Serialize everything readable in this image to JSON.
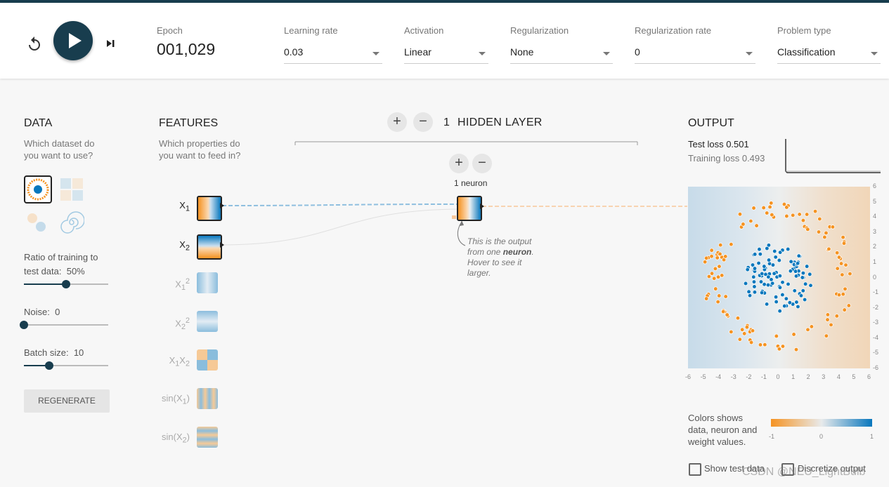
{
  "controls": {
    "reset_icon": "reset-icon",
    "play_icon": "play-icon",
    "step_icon": "step-forward-icon"
  },
  "epoch": {
    "label": "Epoch",
    "value": "001,029"
  },
  "learning_rate": {
    "label": "Learning rate",
    "value": "0.03"
  },
  "activation": {
    "label": "Activation",
    "value": "Linear"
  },
  "regularization": {
    "label": "Regularization",
    "value": "None"
  },
  "regularization_rate": {
    "label": "Regularization rate",
    "value": "0"
  },
  "problem_type": {
    "label": "Problem type",
    "value": "Classification"
  },
  "data": {
    "title": "DATA",
    "subtitle1": "Which dataset do",
    "subtitle2": "you want to use?",
    "ratio_label": "Ratio of training to",
    "ratio_label2": "test data:",
    "ratio_value": "50%",
    "ratio_fraction": 0.5,
    "noise_label": "Noise:",
    "noise_value": "0",
    "noise_fraction": 0,
    "batch_label": "Batch size:",
    "batch_value": "10",
    "batch_fraction": 0.3,
    "regenerate": "REGENERATE"
  },
  "features": {
    "title": "FEATURES",
    "subtitle1": "Which properties do",
    "subtitle2": "you want to feed in?",
    "items": [
      {
        "base": "X",
        "sub": "1",
        "sup": ""
      },
      {
        "base": "X",
        "sub": "2",
        "sup": ""
      },
      {
        "base": "X",
        "sub": "1",
        "sup": "2"
      },
      {
        "base": "X",
        "sub": "2",
        "sup": "2"
      },
      {
        "base": "X",
        "sub": "1",
        "base2": "X",
        "sub2": "2"
      },
      {
        "base": "sin(X",
        "sub": "1",
        "tail": ")"
      },
      {
        "base": "sin(X",
        "sub": "2",
        "tail": ")"
      }
    ]
  },
  "hidden": {
    "count": "1",
    "title": "HIDDEN LAYER",
    "plus": "+",
    "minus": "−",
    "neuron_label": "1 neuron",
    "tooltip_a": "This is the output from one",
    "tooltip_b": "neuron",
    "tooltip_c": ". Hover to see it larger."
  },
  "output": {
    "title": "OUTPUT",
    "test_loss_label": "Test loss",
    "test_loss": "0.501",
    "train_loss_label": "Training loss",
    "train_loss": "0.493",
    "axis_ticks": [
      "-6",
      "-5",
      "-4",
      "-3",
      "-2",
      "-1",
      "0",
      "1",
      "2",
      "3",
      "4",
      "5",
      "6"
    ],
    "legend_text1": "Colors shows",
    "legend_text2": "data, neuron and",
    "legend_text3": "weight values.",
    "legend_min": "-1",
    "legend_mid": "0",
    "legend_max": "1",
    "show_test": "Show test data",
    "discretize": "Discretize output"
  },
  "colors": {
    "orange": "#f59322",
    "blue": "#0877bd",
    "navy": "#183d4e"
  },
  "watermark": "CSDN @NEU_LightBulb"
}
